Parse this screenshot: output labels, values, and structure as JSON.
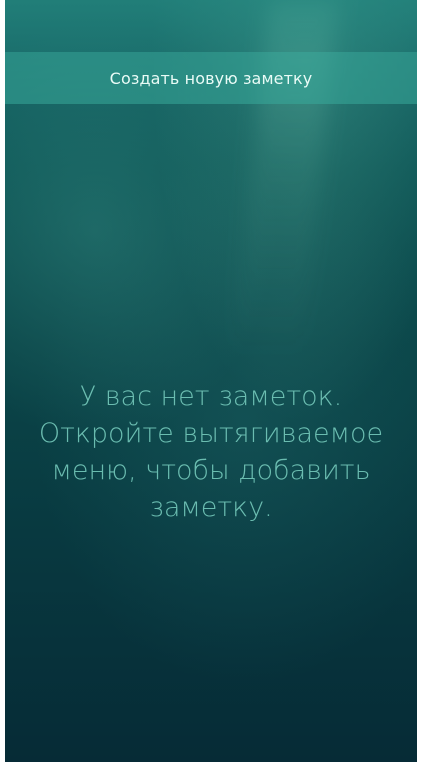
{
  "pulley_menu": {
    "create_note_label": "Создать новую заметку"
  },
  "empty_view": {
    "line1": "У вас нет заметок.",
    "line2": "Откройте вытягиваемое",
    "line3": "меню, чтобы добавить",
    "line4": "заметку."
  },
  "colors": {
    "menu_highlight": "#38aa9b",
    "placeholder_text": "#78cdbe",
    "background_top": "#1b6d6d",
    "background_bottom": "#062b36"
  }
}
